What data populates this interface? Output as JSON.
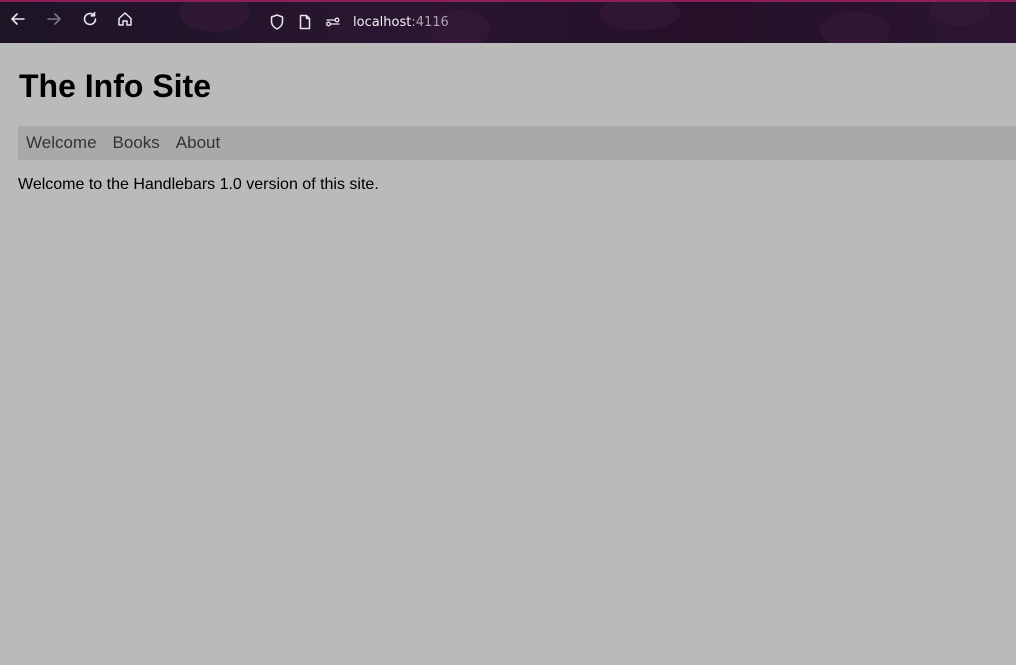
{
  "browser": {
    "address": {
      "host": "localhost",
      "port": ":4116"
    },
    "icons": [
      "back-icon",
      "forward-icon",
      "reload-icon",
      "home-icon",
      "shield-icon",
      "page-icon",
      "connection-icon"
    ],
    "colors": {
      "toolbar_bg": "#1d1426",
      "toolbar_accent": "#8c1f5a"
    }
  },
  "page": {
    "title": "The Info Site",
    "nav": [
      {
        "label": "Welcome"
      },
      {
        "label": "Books"
      },
      {
        "label": "About"
      }
    ],
    "message": "Welcome to the Handlebars 1.0 version of this site.",
    "colors": {
      "background": "#bababa",
      "nav_bg": "#a9a9a9"
    }
  }
}
